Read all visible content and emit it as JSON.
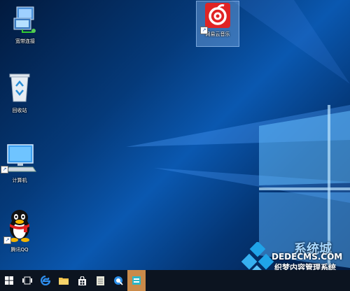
{
  "desktop": {
    "icons": [
      {
        "label": "宽带连接",
        "icon": "network-connection-icon"
      },
      {
        "label": "网易云音乐",
        "icon": "netease-music-icon"
      },
      {
        "label": "回收站",
        "icon": "recycle-bin-icon"
      },
      {
        "label": "计算机",
        "icon": "computer-icon"
      },
      {
        "label": "腾讯QQ",
        "icon": "qq-penguin-icon"
      }
    ]
  },
  "taskbar": {
    "buttons": [
      "start-icon",
      "task-view-icon",
      "edge-icon",
      "file-explorer-icon",
      "store-icon",
      "notepad-icon",
      "qq-browser-icon",
      "active-app-icon"
    ]
  },
  "watermark": {
    "site_text": "DEDECMS.COM",
    "cn_text": "织梦内容管理系统",
    "brand_text": "系统城"
  },
  "colors": {
    "taskbar": "#0c1420",
    "accent": "#c98a4a",
    "desktop": "#053a7a"
  }
}
